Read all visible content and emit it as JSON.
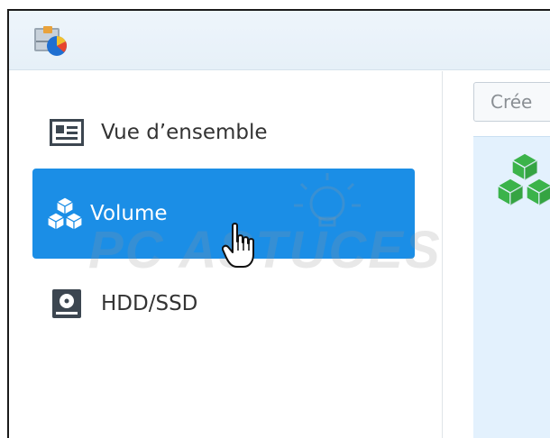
{
  "sidebar": {
    "items": [
      {
        "label": "Vue d’ensemble",
        "icon": "overview-card-icon",
        "active": false
      },
      {
        "label": "Volume",
        "icon": "cubes-icon",
        "active": true
      },
      {
        "label": "HDD/SSD",
        "icon": "hard-drive-icon",
        "active": false
      }
    ]
  },
  "main": {
    "create_button_label": "Crée",
    "content_icon": "green-cubes-icon"
  },
  "watermark": {
    "text": "PC ASTUCES"
  },
  "colors": {
    "active_item_bg": "#1b8ee6",
    "content_panel_bg": "#e3f1fd",
    "cube_green": "#3bb34a"
  }
}
